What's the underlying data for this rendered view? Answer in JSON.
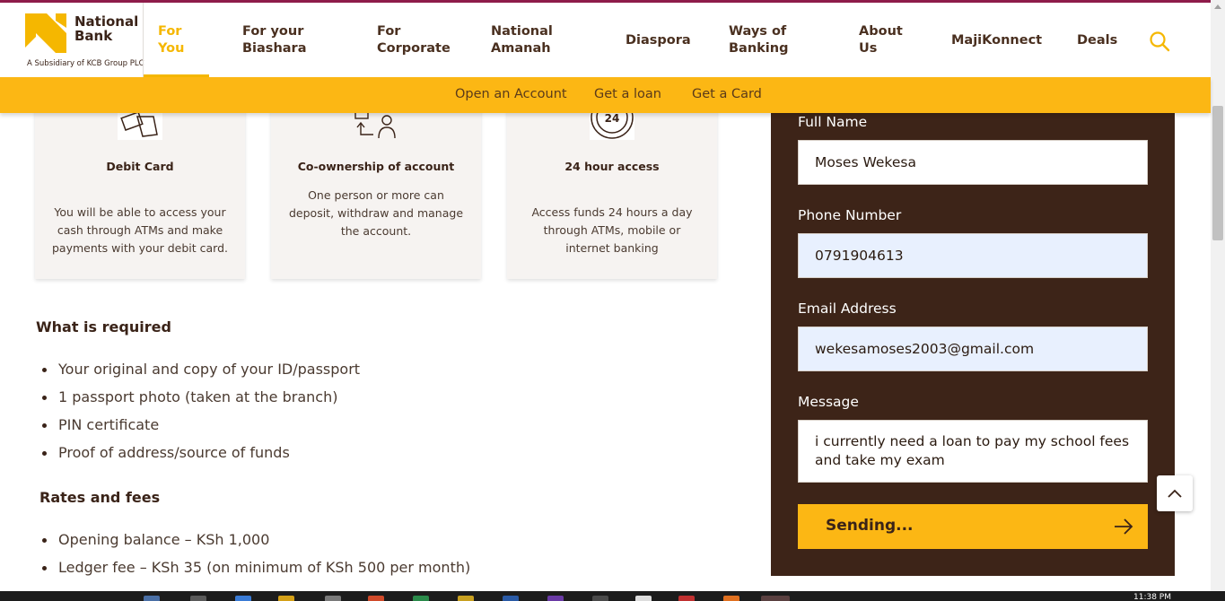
{
  "brand": {
    "name": "National Bank",
    "subsidiary": "A Subsidiary of KCB Group PLC"
  },
  "nav": [
    {
      "label": "For You",
      "active": true
    },
    {
      "label": "For your Biashara"
    },
    {
      "label": "For Corporate"
    },
    {
      "label": "National Amanah"
    },
    {
      "label": "Diaspora"
    },
    {
      "label": "Ways of Banking"
    },
    {
      "label": "About Us"
    },
    {
      "label": "MajiKonnect"
    },
    {
      "label": "Deals"
    }
  ],
  "subnav": [
    "Open an Account",
    "Get a loan",
    "Get a Card"
  ],
  "cards": [
    {
      "icon": "debit-card-icon",
      "title": "Debit Card",
      "desc": "You will be able to access your cash through ATMs and make payments with your debit card."
    },
    {
      "icon": "co-ownership-icon",
      "title": "Co-ownership of account",
      "desc": "One person or more can deposit, withdraw and manage the account."
    },
    {
      "icon": "clock-24-icon",
      "title": "24 hour access",
      "desc": "Access funds 24 hours a day through ATMs, mobile or internet banking"
    }
  ],
  "required": {
    "title": "What is required",
    "items": [
      "Your original and copy of your ID/passport",
      "1 passport photo (taken at the branch)",
      "PIN certificate",
      "Proof of address/source of funds"
    ]
  },
  "rates": {
    "title": "Rates and fees",
    "items": [
      "Opening balance – KSh 1,000",
      "Ledger fee – KSh 35 (on minimum of KSh 500 per month)"
    ]
  },
  "form": {
    "full_name_label": "Full Name",
    "full_name_value": "Moses Wekesa",
    "phone_label": "Phone Number",
    "phone_value": "0791904613",
    "email_label": "Email Address",
    "email_value": "wekesamoses2003@gmail.com",
    "message_label": "Message",
    "message_value": "i currently need a loan to pay my school fees and take my exam",
    "submit_label": "Sending..."
  },
  "taskbar": {
    "time": "11:38 PM"
  },
  "colors": {
    "accent": "#fcb714",
    "brown": "#3d2418",
    "top_stripe": "#8e1b4a"
  }
}
